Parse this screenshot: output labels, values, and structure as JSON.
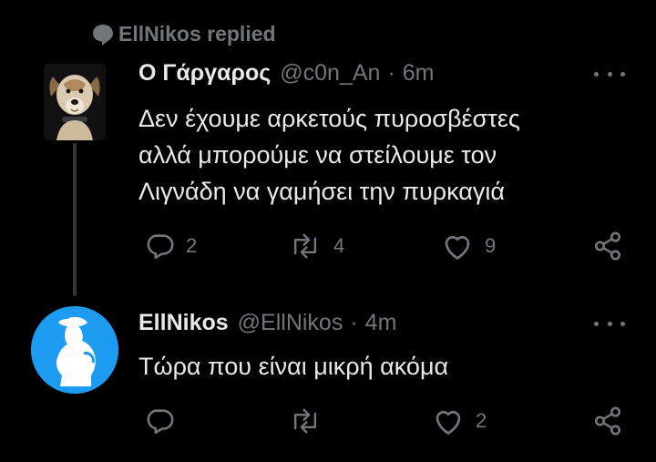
{
  "context": {
    "icon": "speech-bubble-icon",
    "text": "EllNikos replied"
  },
  "tweets": [
    {
      "name": "Ο Γάργαρος",
      "handle": "@c0n_An",
      "dot": "·",
      "time": "6m",
      "lines": [
        "Δεν έχουμε αρκετούς πυροσβέστες",
        "αλλά μπορούμε να στείλουμε τον",
        "Λιγνάδη να γαμήσει την πυρκαγιά"
      ],
      "replies": "2",
      "retweets": "4",
      "likes": "9"
    },
    {
      "name": "EllNikos",
      "handle": "@EllNikos",
      "dot": "·",
      "time": "4m",
      "lines": [
        "Τώρα που είναι μικρή ακόμα"
      ],
      "replies": "",
      "retweets": "",
      "likes": "2"
    }
  ],
  "colors": {
    "background": "#000000",
    "text": "#e7e9ea",
    "muted": "#71767b",
    "avatar_bg": "#1d9bf0",
    "thread_line": "#333639"
  }
}
